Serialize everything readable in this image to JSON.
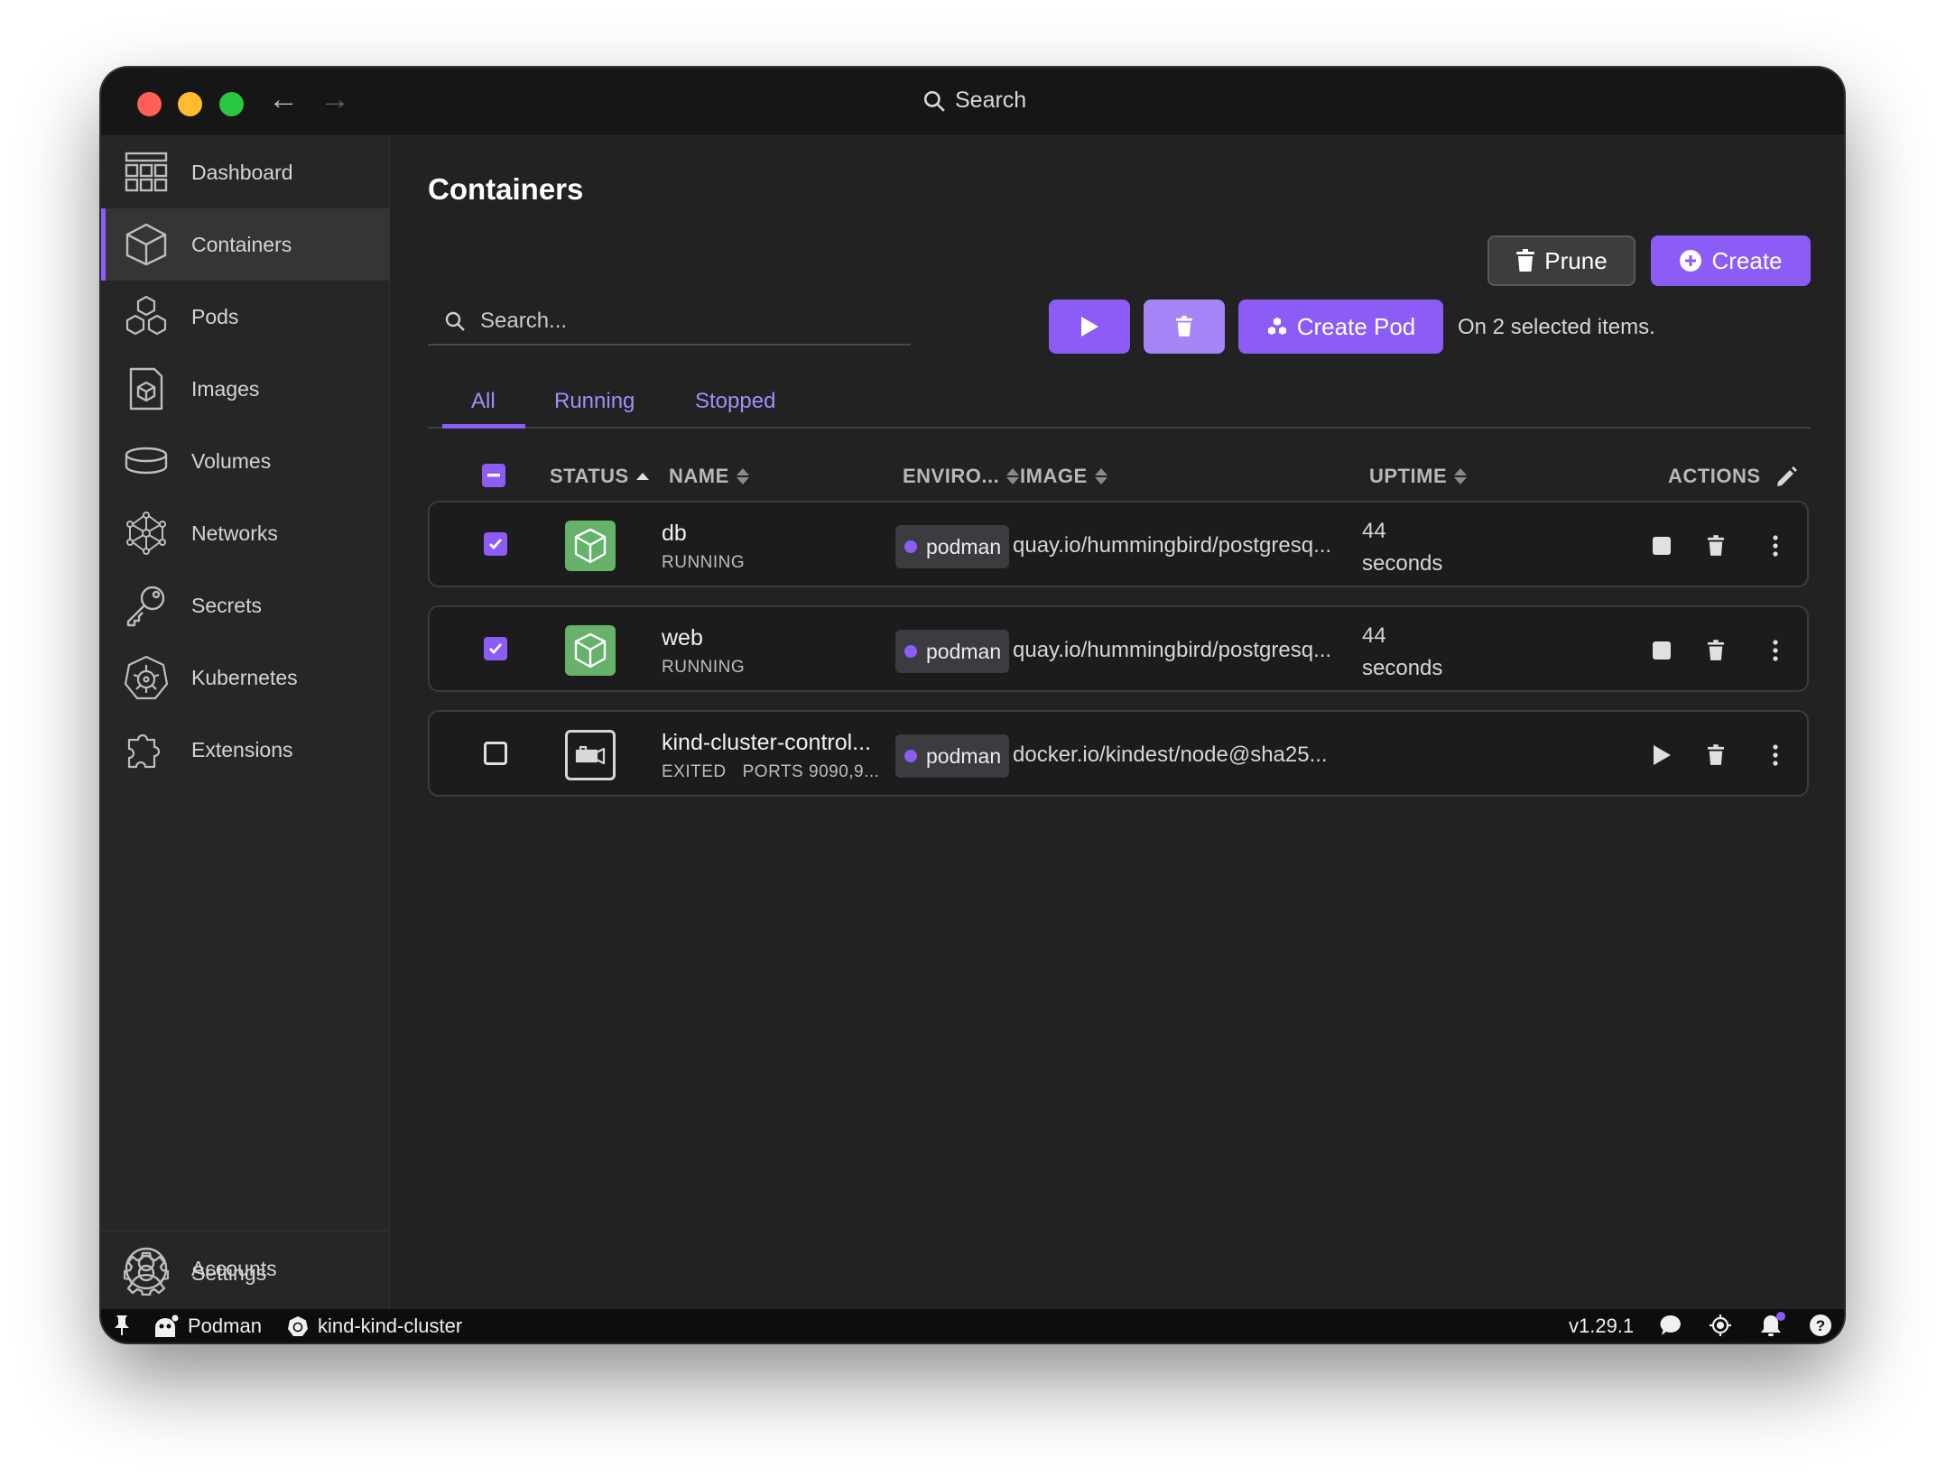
{
  "titlebar": {
    "search_label": "Search"
  },
  "sidebar": {
    "items": [
      {
        "label": "Dashboard",
        "icon": "dashboard-icon"
      },
      {
        "label": "Containers",
        "icon": "container-icon"
      },
      {
        "label": "Pods",
        "icon": "pods-icon"
      },
      {
        "label": "Images",
        "icon": "image-icon"
      },
      {
        "label": "Volumes",
        "icon": "volume-icon"
      },
      {
        "label": "Networks",
        "icon": "network-icon"
      },
      {
        "label": "Secrets",
        "icon": "key-icon"
      },
      {
        "label": "Kubernetes",
        "icon": "kubernetes-icon"
      },
      {
        "label": "Extensions",
        "icon": "puzzle-icon"
      }
    ],
    "bottom_items": [
      {
        "label": "Accounts",
        "icon": "account-icon"
      },
      {
        "label": "Settings",
        "icon": "gear-icon"
      }
    ],
    "active": "Containers"
  },
  "main": {
    "title": "Containers",
    "prune_label": "Prune",
    "create_label": "Create",
    "search_placeholder": "Search...",
    "create_pod_label": "Create Pod",
    "selection_note": "On 2 selected items.",
    "tabs": [
      {
        "label": "All"
      },
      {
        "label": "Running"
      },
      {
        "label": "Stopped"
      }
    ],
    "active_tab": "All",
    "columns": {
      "status": "STATUS",
      "name": "NAME",
      "environment": "ENVIRO...",
      "image": "IMAGE",
      "uptime": "UPTIME",
      "actions": "ACTIONS"
    },
    "rows": [
      {
        "checked": true,
        "name": "db",
        "state": "RUNNING",
        "ports": "",
        "environment": "podman",
        "image": "quay.io/hummingbird/postgresq...",
        "uptime_value": "44",
        "uptime_unit": "seconds"
      },
      {
        "checked": true,
        "name": "web",
        "state": "RUNNING",
        "ports": "",
        "environment": "podman",
        "image": "quay.io/hummingbird/postgresq...",
        "uptime_value": "44",
        "uptime_unit": "seconds"
      },
      {
        "checked": false,
        "name": "kind-cluster-control...",
        "state": "EXITED",
        "ports": "PORTS 9090,9...",
        "environment": "podman",
        "image": "docker.io/kindest/node@sha25...",
        "uptime_value": "",
        "uptime_unit": ""
      }
    ]
  },
  "statusbar": {
    "engine": "Podman",
    "cluster": "kind-kind-cluster",
    "version": "v1.29.1"
  },
  "colors": {
    "accent": "#8b5cf6",
    "running": "#66b26a",
    "background": "#222222"
  }
}
